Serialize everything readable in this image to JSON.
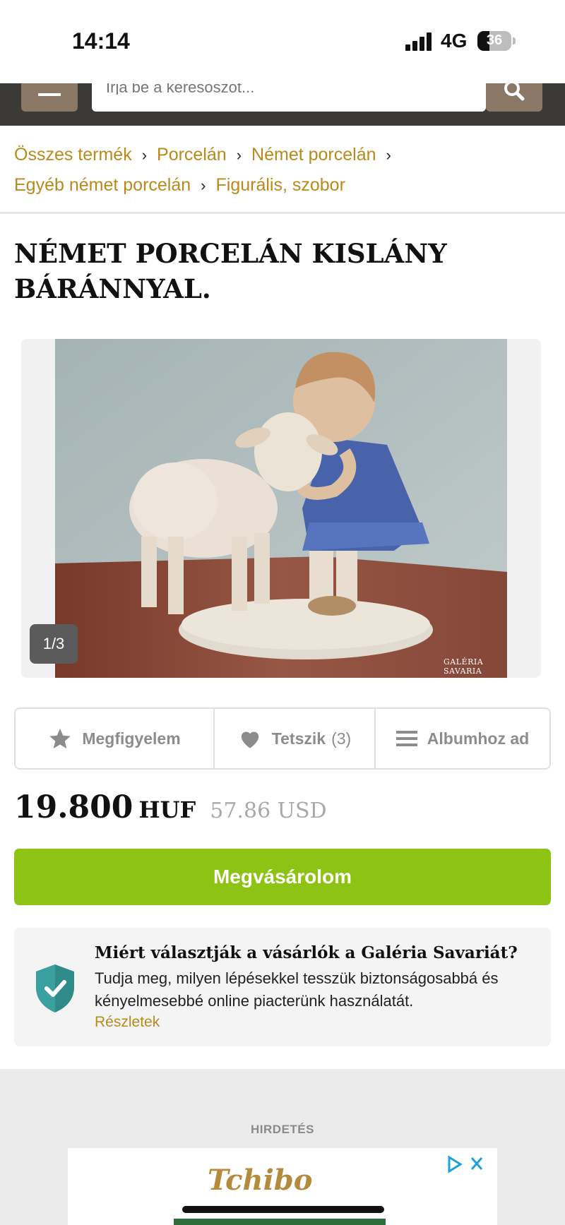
{
  "status_bar": {
    "time": "14:14",
    "network": "4G",
    "battery": "36",
    "battery_level": 0.36
  },
  "search": {
    "placeholder": "Írja be a keresőszót..."
  },
  "breadcrumb": [
    "Összes termék",
    "Porcelán",
    "Német porcelán",
    "Egyéb német porcelán",
    "Figurális, szobor"
  ],
  "product": {
    "title": "NÉMET PORCELÁN KISLÁNY BÁRÁNNYAL.",
    "image_counter": "1/3",
    "watermark": "GALÉRIA SAVARIA",
    "price": "19.800",
    "currency": "HUF",
    "price_usd": "57.86 USD",
    "buy_label": "Megvásárolom"
  },
  "actions": {
    "watch": "Megfigyelem",
    "like": "Tetszik",
    "like_count": "(3)",
    "album": "Albumhoz ad"
  },
  "trust": {
    "heading": "Miért választják a vásárlók a Galéria Savariát?",
    "text": "Tudja meg, milyen lépésekkel tesszük biztonságosabbá és kényelmesebbé online piacterünk használatát.",
    "link": "Részletek"
  },
  "ad": {
    "label": "HIRDETÉS",
    "brand": "Tchibo"
  },
  "icons": [
    "menu-icon",
    "search-icon",
    "star-icon",
    "heart-icon",
    "list-icon",
    "shield-check-icon",
    "adchoices-icon",
    "close-icon"
  ],
  "colors": {
    "accent_gold": "#b88a1c",
    "buy_green": "#8cc314",
    "header_dark": "#3b3a37",
    "header_brown": "#8a7766"
  }
}
